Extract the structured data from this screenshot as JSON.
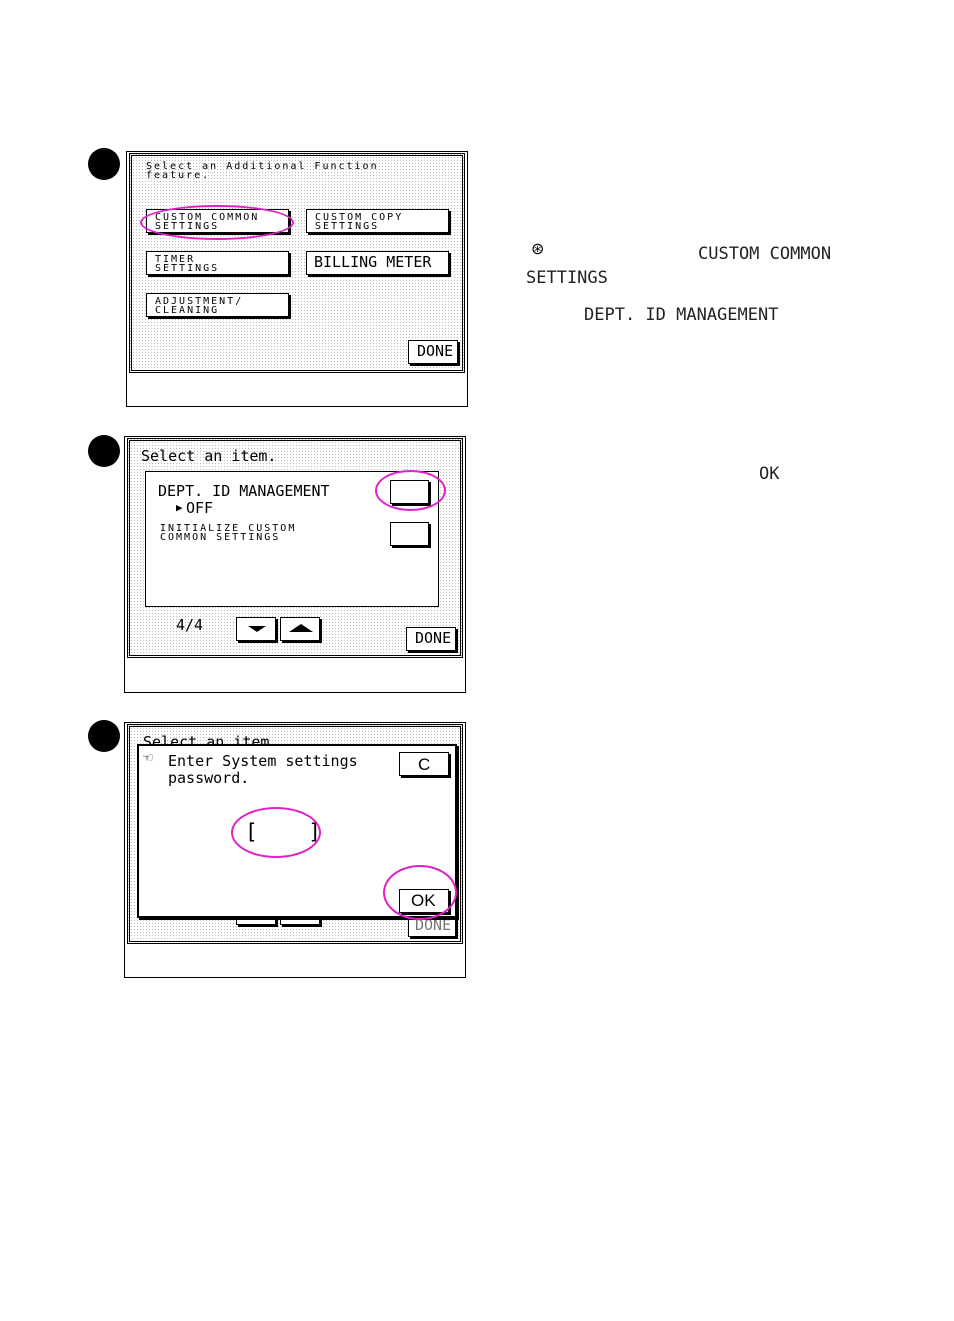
{
  "screen1": {
    "prompt": "Select an Additional Function\nfeature.",
    "buttons": {
      "custom_common": "CUSTOM COMMON\nSETTINGS",
      "custom_copy": "CUSTOM COPY\nSETTINGS",
      "timer": "TIMER\nSETTINGS",
      "billing_meter": "BILLING METER",
      "adjustment": "ADJUSTMENT/\nCLEANING",
      "done": "DONE"
    }
  },
  "screen2": {
    "prompt": "Select an item.",
    "item1_label": "DEPT. ID MANAGEMENT",
    "item1_value": "OFF",
    "item2_label": "INITIALIZE CUSTOM\nCOMMON SETTINGS",
    "page_indicator": "4/4",
    "done": "DONE"
  },
  "screen3": {
    "background_prompt": "Select an item.",
    "dialog_text": "Enter System settings\npassword.",
    "clear_button": "C",
    "ok_button": "OK",
    "password_field": "[    ]",
    "background_done": "DONE"
  },
  "instructions": {
    "line1_key": "CUSTOM COMMON",
    "line2": "SETTINGS",
    "line3": "DEPT. ID MANAGEMENT",
    "line4": "OK"
  }
}
